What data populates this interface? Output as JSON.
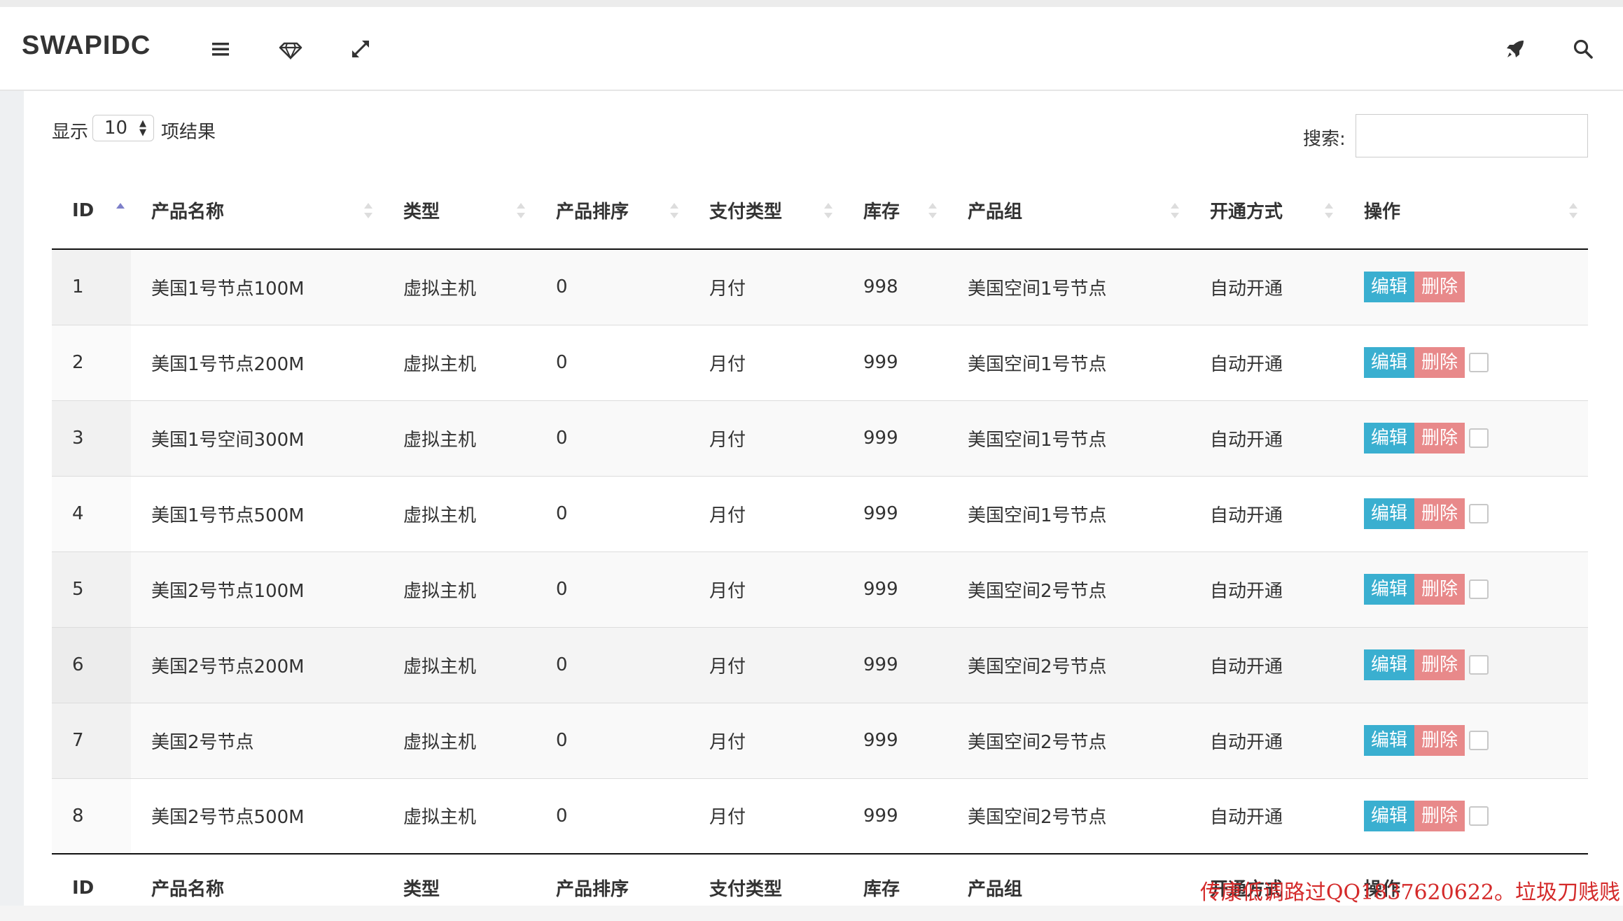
{
  "brand": "SWAPIDC",
  "icons": {
    "menu": "hamburger-menu-icon",
    "diamond": "diamond-icon",
    "fullscreen": "expand-arrows-icon",
    "rocket": "rocket-icon",
    "search": "search-icon"
  },
  "length_menu": {
    "prefix": "显示",
    "value": "10",
    "suffix": "项结果"
  },
  "search": {
    "label": "搜索:",
    "value": ""
  },
  "columns": [
    "ID",
    "产品名称",
    "类型",
    "产品排序",
    "支付类型",
    "库存",
    "产品组",
    "开通方式",
    "操作"
  ],
  "footer_columns": [
    "ID",
    "产品名称",
    "类型",
    "产品排序",
    "支付类型",
    "库存",
    "产品组",
    "开通方式",
    "操作"
  ],
  "actions": {
    "edit": "编辑",
    "delete": "删除"
  },
  "rows": [
    {
      "id": "1",
      "name": "美国1号节点100M",
      "type": "虚拟主机",
      "order": "0",
      "pay": "月付",
      "stock": "998",
      "group": "美国空间1号节点",
      "open": "自动开通"
    },
    {
      "id": "2",
      "name": "美国1号节点200M",
      "type": "虚拟主机",
      "order": "0",
      "pay": "月付",
      "stock": "999",
      "group": "美国空间1号节点",
      "open": "自动开通"
    },
    {
      "id": "3",
      "name": "美国1号空间300M",
      "type": "虚拟主机",
      "order": "0",
      "pay": "月付",
      "stock": "999",
      "group": "美国空间1号节点",
      "open": "自动开通"
    },
    {
      "id": "4",
      "name": "美国1号节点500M",
      "type": "虚拟主机",
      "order": "0",
      "pay": "月付",
      "stock": "999",
      "group": "美国空间1号节点",
      "open": "自动开通"
    },
    {
      "id": "5",
      "name": "美国2号节点100M",
      "type": "虚拟主机",
      "order": "0",
      "pay": "月付",
      "stock": "999",
      "group": "美国空间2号节点",
      "open": "自动开通"
    },
    {
      "id": "6",
      "name": "美国2号节点200M",
      "type": "虚拟主机",
      "order": "0",
      "pay": "月付",
      "stock": "999",
      "group": "美国空间2号节点",
      "open": "自动开通"
    },
    {
      "id": "7",
      "name": "美国2号节点",
      "type": "虚拟主机",
      "order": "0",
      "pay": "月付",
      "stock": "999",
      "group": "美国空间2号节点",
      "open": "自动开通"
    },
    {
      "id": "8",
      "name": "美国2号节点500M",
      "type": "虚拟主机",
      "order": "0",
      "pay": "月付",
      "stock": "999",
      "group": "美国空间2号节点",
      "open": "自动开通"
    }
  ],
  "watermark": "传康低调路过QQ1837620622。垃圾刀贱贱"
}
